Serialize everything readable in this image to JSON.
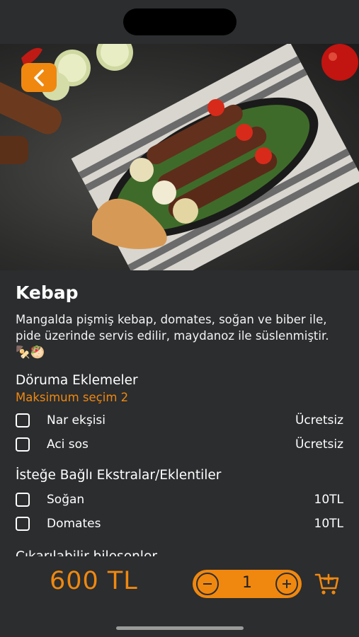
{
  "product": {
    "name": "Kebap",
    "description": "Mangalda pişmiş kebap, domates, soğan ve biber ile, pide üzerinde servis edilir, maydanoz ile süslenmiştir. 🍢🥙"
  },
  "sections": [
    {
      "title": "Döruma Eklemeler",
      "subtitle": "Maksimum seçim 2",
      "options": [
        {
          "label": "Nar ekşisi",
          "price": "Ücretsiz",
          "checked": false
        },
        {
          "label": "Aci sos",
          "price": "Ücretsiz",
          "checked": false
        }
      ]
    },
    {
      "title": "İsteğe Bağlı Ekstralar/Eklentiler",
      "options": [
        {
          "label": "Soğan",
          "price": "10TL",
          "checked": false
        },
        {
          "label": "Domates",
          "price": "10TL",
          "checked": false
        }
      ]
    },
    {
      "title": "Çıkarılabilir bileşenler"
    }
  ],
  "footer": {
    "price": "600 TL",
    "quantity": "1"
  },
  "icons": {
    "back": "chevron-left-icon",
    "minus": "minus-icon",
    "plus": "plus-icon",
    "cart": "add-to-cart-icon"
  },
  "colors": {
    "accent": "#f0880f",
    "background": "#2b2d2f",
    "text": "#ffffff"
  }
}
